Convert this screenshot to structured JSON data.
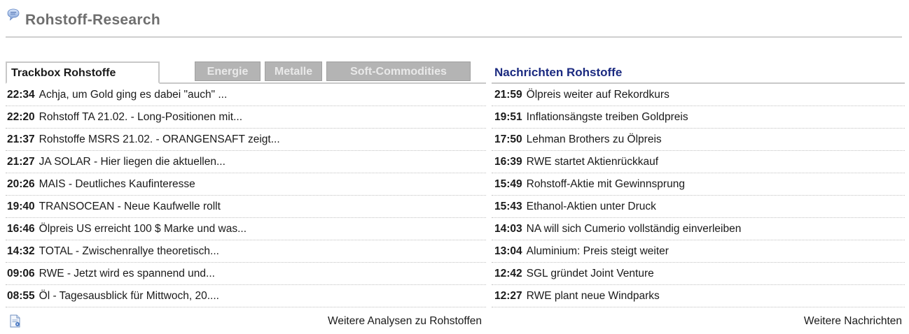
{
  "header": {
    "title": "Rohstoff-Research"
  },
  "tabs": [
    {
      "label": "Trackbox Rohstoffe",
      "active": true
    },
    {
      "label": "Energie",
      "active": false
    },
    {
      "label": "Metalle",
      "active": false
    },
    {
      "label": "Soft-Commodities",
      "active": false
    }
  ],
  "trackbox": {
    "items": [
      {
        "time": "22:34",
        "text": "Achja, um Gold ging es dabei \"auch\" ..."
      },
      {
        "time": "22:20",
        "text": "Rohstoff TA 21.02. - Long-Positionen mit..."
      },
      {
        "time": "21:37",
        "text": "Rohstoffe MSRS 21.02. - ORANGENSAFT zeigt..."
      },
      {
        "time": "21:27",
        "text": "JA SOLAR - Hier liegen die aktuellen..."
      },
      {
        "time": "20:26",
        "text": "MAIS - Deutliches Kaufinteresse"
      },
      {
        "time": "19:40",
        "text": "TRANSOCEAN - Neue Kaufwelle rollt"
      },
      {
        "time": "16:46",
        "text": "Ölpreis US erreicht 100 $ Marke und was..."
      },
      {
        "time": "14:32",
        "text": "TOTAL - Zwischenrallye theoretisch..."
      },
      {
        "time": "09:06",
        "text": "RWE - Jetzt wird es spannend und..."
      },
      {
        "time": "08:55",
        "text": "Öl - Tagesausblick für Mittwoch, 20...."
      }
    ],
    "more_label": "Weitere Analysen zu Rohstoffen"
  },
  "news": {
    "title": "Nachrichten Rohstoffe",
    "items": [
      {
        "time": "21:59",
        "text": "Ölpreis weiter auf Rekordkurs"
      },
      {
        "time": "19:51",
        "text": "Inflationsängste treiben Goldpreis"
      },
      {
        "time": "17:50",
        "text": "Lehman Brothers zu Ölpreis"
      },
      {
        "time": "16:39",
        "text": "RWE startet Aktienrückkauf"
      },
      {
        "time": "15:49",
        "text": "Rohstoff-Aktie mit Gewinnsprung"
      },
      {
        "time": "15:43",
        "text": "Ethanol-Aktien unter Druck"
      },
      {
        "time": "14:03",
        "text": "NA will sich Cumerio vollständig einverleiben"
      },
      {
        "time": "13:04",
        "text": "Aluminium: Preis steigt weiter"
      },
      {
        "time": "12:42",
        "text": "SGL gründet Joint Venture"
      },
      {
        "time": "12:27",
        "text": "RWE plant neue Windparks"
      }
    ],
    "more_label": "Weitere Nachrichten"
  },
  "icons": {
    "header": "speech-bubble-icon",
    "footer": "document-icon"
  },
  "colors": {
    "title_gray": "#6e6e6e",
    "news_title_blue": "#1b2a80",
    "tab_inactive_bg": "#b4b4b4"
  }
}
